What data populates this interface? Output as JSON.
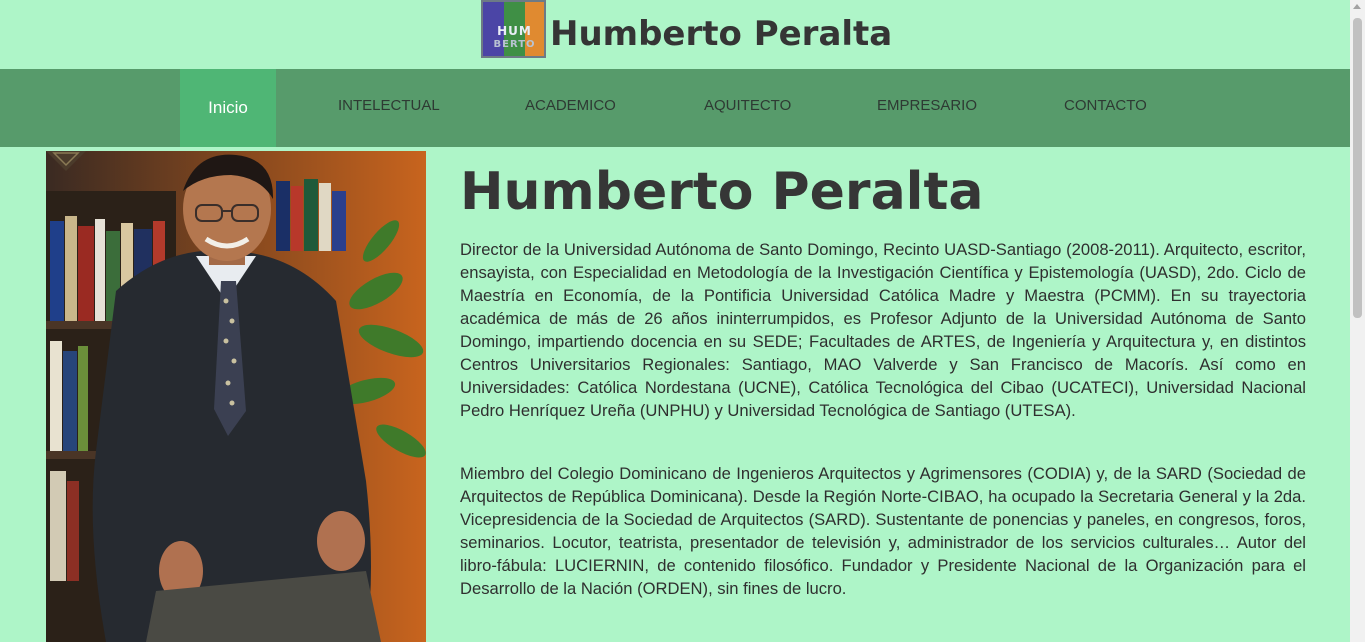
{
  "header": {
    "logo": {
      "icon": "site-logo",
      "text_top": "HUM",
      "text_bottom": "BERTO"
    },
    "title": "Humberto Peralta"
  },
  "nav": {
    "items": [
      {
        "label": "Inicio",
        "active": true
      },
      {
        "label": "INTELECTUAL",
        "active": false
      },
      {
        "label": "ACADEMICO",
        "active": false
      },
      {
        "label": "AQUITECTO",
        "active": false
      },
      {
        "label": "EMPRESARIO",
        "active": false
      },
      {
        "label": "CONTACTO",
        "active": false
      }
    ]
  },
  "main": {
    "photo": {
      "icon": "portrait-photo"
    },
    "heading": "Humberto Peralta",
    "paragraphs": [
      "Director de la Universidad Autónoma de Santo Domingo, Recinto UASD-Santiago (2008-2011). Arquitecto, escritor, ensayista, con Especialidad en Metodología de la Investigación Científica y Epistemología (UASD), 2do. Ciclo de Maestría en Economía, de la Pontificia Universidad Católica Madre y Maestra (PCMM). En su trayectoria académica de más de 26 años ininterrumpidos, es Profesor Adjunto de la Universidad Autónoma de Santo Domingo, impartiendo docencia en su SEDE; Facultades de ARTES, de Ingeniería y Arquitectura y, en distintos Centros Universitarios Regionales: Santiago, MAO Valverde y San Francisco de Macorís. Así como en Universidades: Católica Nordestana (UCNE), Católica Tecnológica del Cibao (UCATECI), Universidad Nacional Pedro Henríquez Ureña (UNPHU) y Universidad Tecnológica de Santiago (UTESA).",
      "Miembro del Colegio Dominicano de Ingenieros Arquitectos y Agrimensores (CODIA) y, de la SARD (Sociedad de Arquitectos de República Dominicana). Desde la Región Norte-CIBAO, ha ocupado la Secretaria General y la 2da. Vicepresidencia de la Sociedad de Arquitectos (SARD). Sustentante de ponencias y paneles, en congresos, foros, seminarios. Locutor, teatrista, presentador de televisión y, administrador de los servicios culturales… Autor del libro-fábula: LUCIERNIN, de contenido filosófico. Fundador y Presidente Nacional de la Organización para el Desarrollo de la Nación (ORDEN), sin fines de lucro."
    ]
  },
  "colors": {
    "page_bg": "#aef5c8",
    "nav_bg": "#579b6b",
    "nav_active_bg": "#4fb675",
    "text": "#2f2f2f"
  }
}
